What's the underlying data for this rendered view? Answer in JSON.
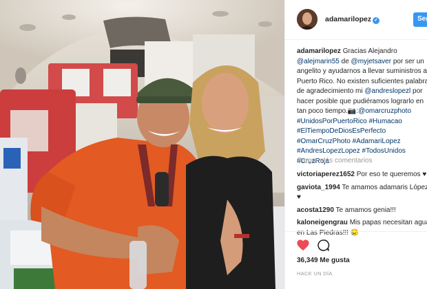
{
  "post": {
    "username": "adamarilopez",
    "follow_label": "Seg",
    "caption_lines": [
      [
        {
          "t": "adamarilopez",
          "c": "bold"
        },
        {
          "t": " Gracias Alejandro",
          "c": ""
        }
      ],
      [
        {
          "t": "@alejmarin55",
          "c": "link"
        },
        {
          "t": " de ",
          "c": ""
        },
        {
          "t": "@myjetsaver",
          "c": "link"
        },
        {
          "t": " por ser un",
          "c": ""
        }
      ],
      [
        {
          "t": "angelito y ayudarnos a llevar suministros a",
          "c": ""
        }
      ],
      [
        {
          "t": "Puerto Rico. No existen suficientes palabras",
          "c": ""
        }
      ],
      [
        {
          "t": "de agradecimiento mi ",
          "c": ""
        },
        {
          "t": "@andreslopezl",
          "c": "link"
        },
        {
          "t": " por",
          "c": ""
        }
      ],
      [
        {
          "t": "hacer posible que pudiéramos lograrlo en",
          "c": ""
        }
      ],
      [
        {
          "t": "tan poco tiempo.📷:",
          "c": ""
        },
        {
          "t": "@omarcruzphoto",
          "c": "link"
        }
      ],
      [
        {
          "t": "#UnidosPorPuertoRico",
          "c": "link"
        },
        {
          "t": " ",
          "c": ""
        },
        {
          "t": "#Humacao",
          "c": "link"
        }
      ],
      [
        {
          "t": "#ElTiempoDeDiosEsPerfecto",
          "c": "link"
        }
      ],
      [
        {
          "t": "#OmarCruzPhoto",
          "c": "link"
        },
        {
          "t": " ",
          "c": ""
        },
        {
          "t": "#AdamariLopez",
          "c": "link"
        }
      ],
      [
        {
          "t": "#AndresLopezLopez",
          "c": "link"
        },
        {
          "t": " ",
          "c": ""
        },
        {
          "t": "#TodosUnidos",
          "c": "link"
        }
      ],
      [
        {
          "t": "#CruzRoja",
          "c": "link"
        }
      ]
    ],
    "load_more": "Cargar más comentarios",
    "comments": [
      {
        "user": "victoriaperez1652",
        "lines": [
          "Por eso te queremos ♥"
        ]
      },
      {
        "user": "gaviota_1994",
        "lines": [
          "Te amamos adamaris López",
          "♥"
        ]
      },
      {
        "user": "acosta1290",
        "lines": [
          "Te amamos genia!!!"
        ]
      },
      {
        "user": "kaloneigengrau",
        "lines": [
          "Mis papas necesitan agua",
          "en Las Piedras!!! 😢"
        ]
      }
    ],
    "likes": "36,349 Me gusta",
    "time": "HACE UN DÍA"
  },
  "colors": {
    "link": "#003569",
    "like_red": "#ed4956",
    "follow_blue": "#3897f0",
    "verified_blue": "#3897f0"
  },
  "icons": {
    "like": "heart-filled-icon",
    "comment": "speech-bubble-icon",
    "verified": "verified-badge-icon"
  }
}
